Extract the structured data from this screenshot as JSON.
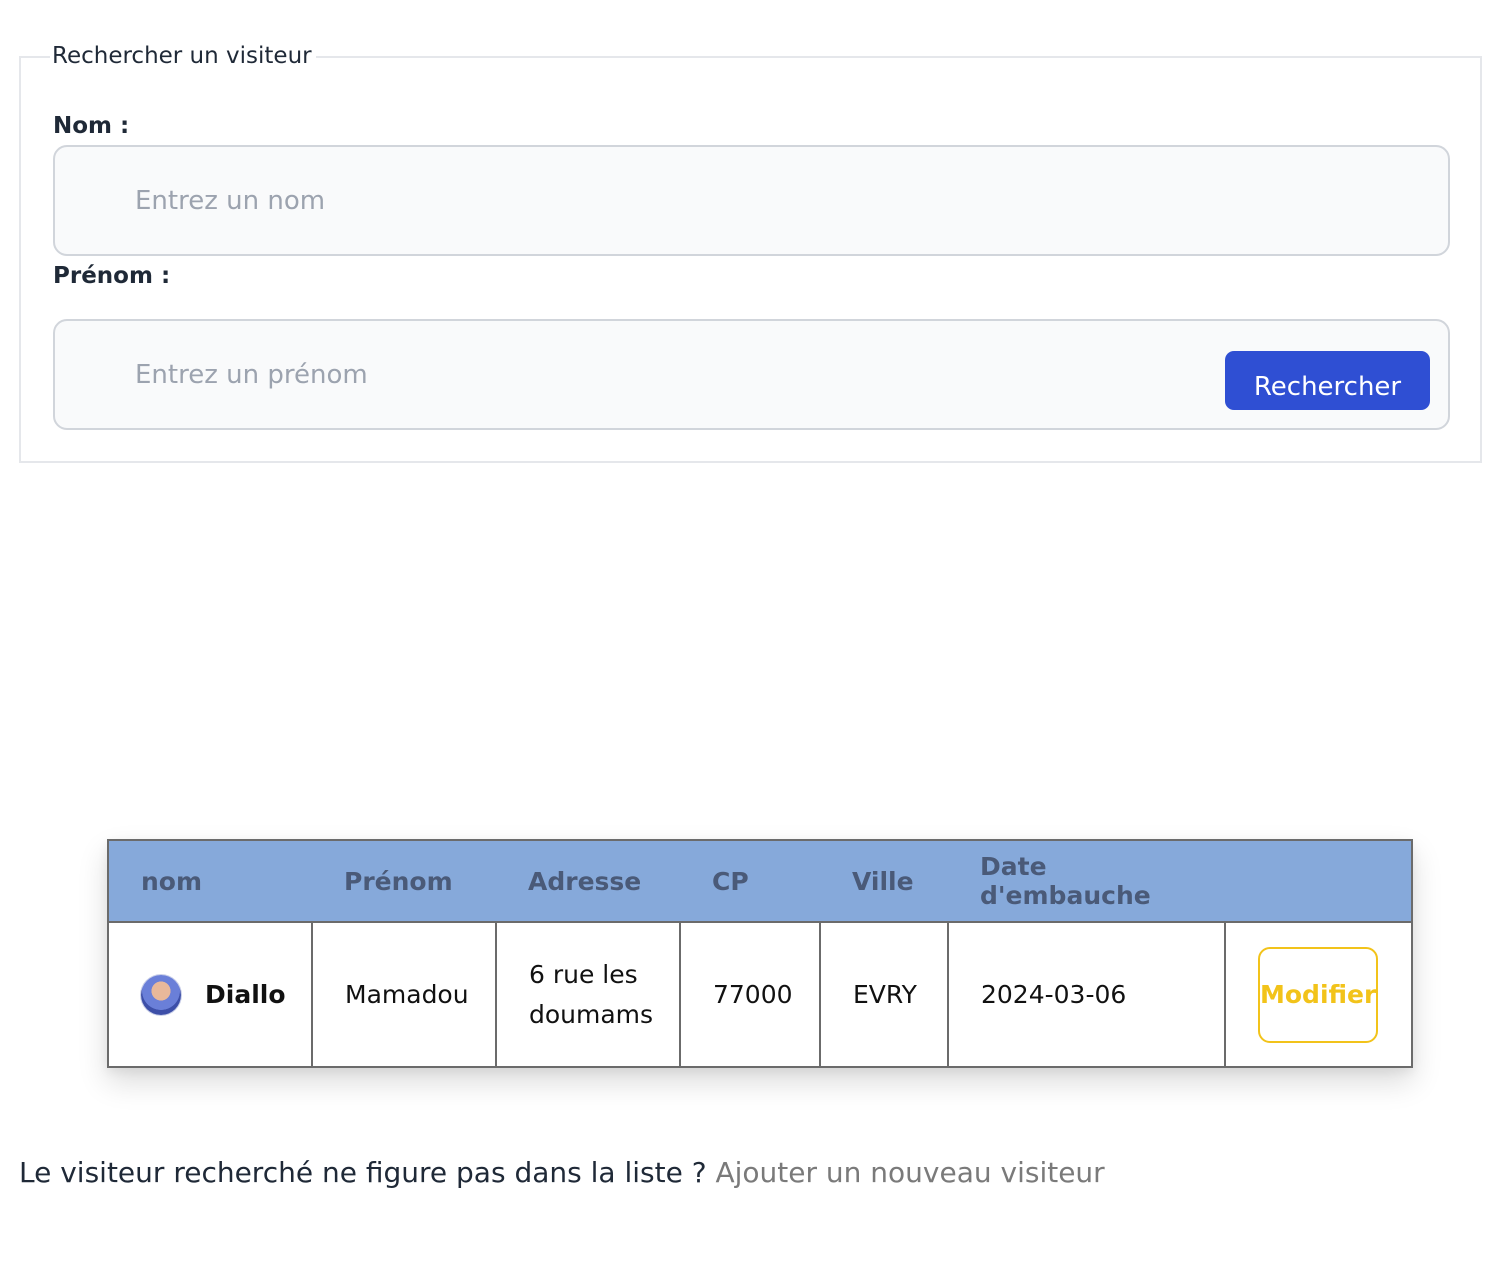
{
  "search": {
    "legend": "Rechercher un visiteur",
    "nom_label": "Nom :",
    "nom_placeholder": "Entrez un nom",
    "nom_value": "",
    "prenom_label": "Prénom :",
    "prenom_placeholder": "Entrez un prénom",
    "prenom_value": "",
    "submit_label": "Rechercher"
  },
  "table": {
    "headers": [
      "nom",
      "Prénom",
      "Adresse",
      "CP",
      "Ville",
      "Date d'embauche",
      ""
    ],
    "rows": [
      {
        "nom": "Diallo",
        "prenom": "Mamadou",
        "adresse": "6 rue les doumams",
        "cp": "77000",
        "ville": "EVRY",
        "date_embauche": "2024-03-06",
        "action_label": "Modifier"
      }
    ]
  },
  "footer": {
    "question": "Le visiteur recherché ne figure pas dans la liste ?",
    "add_link": "Ajouter un nouveau visiteur"
  },
  "colors": {
    "primary_button": "#2f4fd3",
    "table_header_bg": "#86a9da",
    "table_header_text": "#4a5a78",
    "edit_button": "#f2c31a",
    "link": "#7a7a7a"
  },
  "icons": {
    "avatar": "user-avatar-photo"
  }
}
